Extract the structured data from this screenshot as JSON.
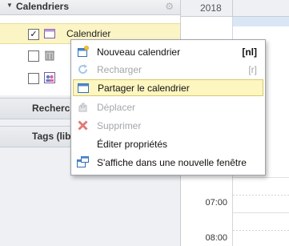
{
  "sidebar": {
    "header": {
      "title": "Calendriers"
    },
    "calendars": [
      {
        "label": "Calendrier",
        "checked": true,
        "icon": "calendar-icon"
      },
      {
        "label": "",
        "checked": false,
        "icon": "trash-icon"
      },
      {
        "label": "",
        "checked": false,
        "icon": "people-icon"
      }
    ],
    "sections": [
      "Recherche",
      "Tags (lib"
    ]
  },
  "grid": {
    "year": "2018",
    "times": [
      "07:00",
      "08:00"
    ]
  },
  "context_menu": {
    "items": [
      {
        "label": "Nouveau calendrier",
        "shortcut": "[nl]",
        "enabled": true,
        "icon": "new-calendar-icon"
      },
      {
        "label": "Recharger",
        "shortcut": "[r]",
        "enabled": false,
        "icon": "reload-icon"
      },
      {
        "label": "Partager le calendrier",
        "shortcut": "",
        "enabled": true,
        "highlighted": true,
        "icon": "share-calendar-icon"
      },
      {
        "label": "Déplacer",
        "shortcut": "",
        "enabled": false,
        "icon": "move-icon"
      },
      {
        "label": "Supprimer",
        "shortcut": "",
        "enabled": false,
        "icon": "delete-icon"
      },
      {
        "label": "Éditer propriétés",
        "shortcut": "",
        "enabled": true,
        "icon": ""
      },
      {
        "label": "S'affiche dans une nouvelle fenêtre",
        "shortcut": "",
        "enabled": true,
        "icon": "new-window-icon"
      }
    ]
  },
  "colors": {
    "selected_row": "#fbf4c4",
    "menu_highlight": "#fdf6c1",
    "accent_blue": "#2f6fb8",
    "delete_red": "#d9534f"
  }
}
